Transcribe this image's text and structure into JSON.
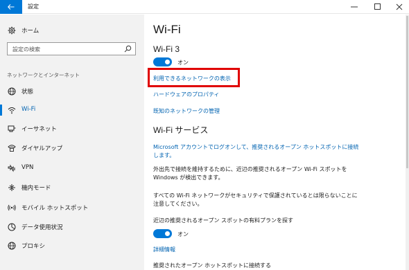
{
  "window": {
    "title": "設定",
    "accent": "#0078d7"
  },
  "sidebar": {
    "home_label": "ホーム",
    "search_placeholder": "設定の検索",
    "section_header": "ネットワークとインターネット",
    "items": [
      {
        "label": "状態",
        "icon": "status-globe-icon"
      },
      {
        "label": "Wi-Fi",
        "icon": "wifi-icon",
        "selected": true
      },
      {
        "label": "イーサネット",
        "icon": "ethernet-icon"
      },
      {
        "label": "ダイヤルアップ",
        "icon": "dialup-icon"
      },
      {
        "label": "VPN",
        "icon": "vpn-icon"
      },
      {
        "label": "機内モード",
        "icon": "airplane-icon"
      },
      {
        "label": "モバイル ホットスポット",
        "icon": "hotspot-icon"
      },
      {
        "label": "データ使用状況",
        "icon": "data-usage-icon"
      },
      {
        "label": "プロキシ",
        "icon": "proxy-globe-icon"
      }
    ]
  },
  "main": {
    "title": "Wi-Fi",
    "adapter_name": "Wi-Fi 3",
    "toggle_label": "オン",
    "links": {
      "show_networks": "利用できるネットワークの表示",
      "hardware_props": "ハードウェアのプロパティ",
      "manage_known": "既知のネットワークの管理"
    },
    "services_title": "Wi-Fi サービス",
    "ms_account_link_line1": "Microsoft アカウントでログオンして、推奨されるオープン ホットスポットに接続",
    "ms_account_link_line2": "します。",
    "desc1_line1": "外出先で接続を維持するために、近辺の推奨されるオープン Wi-Fi スポットを",
    "desc1_line2": "Windows が検出できます。",
    "desc2_line1": "すべての Wi-Fi ネットワークがセキュリティで保護されているとは限らないことに",
    "desc2_line2": "注意してください。",
    "paid_plans_label": "近辺の推奨されるオープン スポットの有料プランを探す",
    "paid_toggle_label": "オン",
    "details_link": "詳細情報",
    "connect_label": "推奨されたオープン ホットスポットに接続する"
  }
}
